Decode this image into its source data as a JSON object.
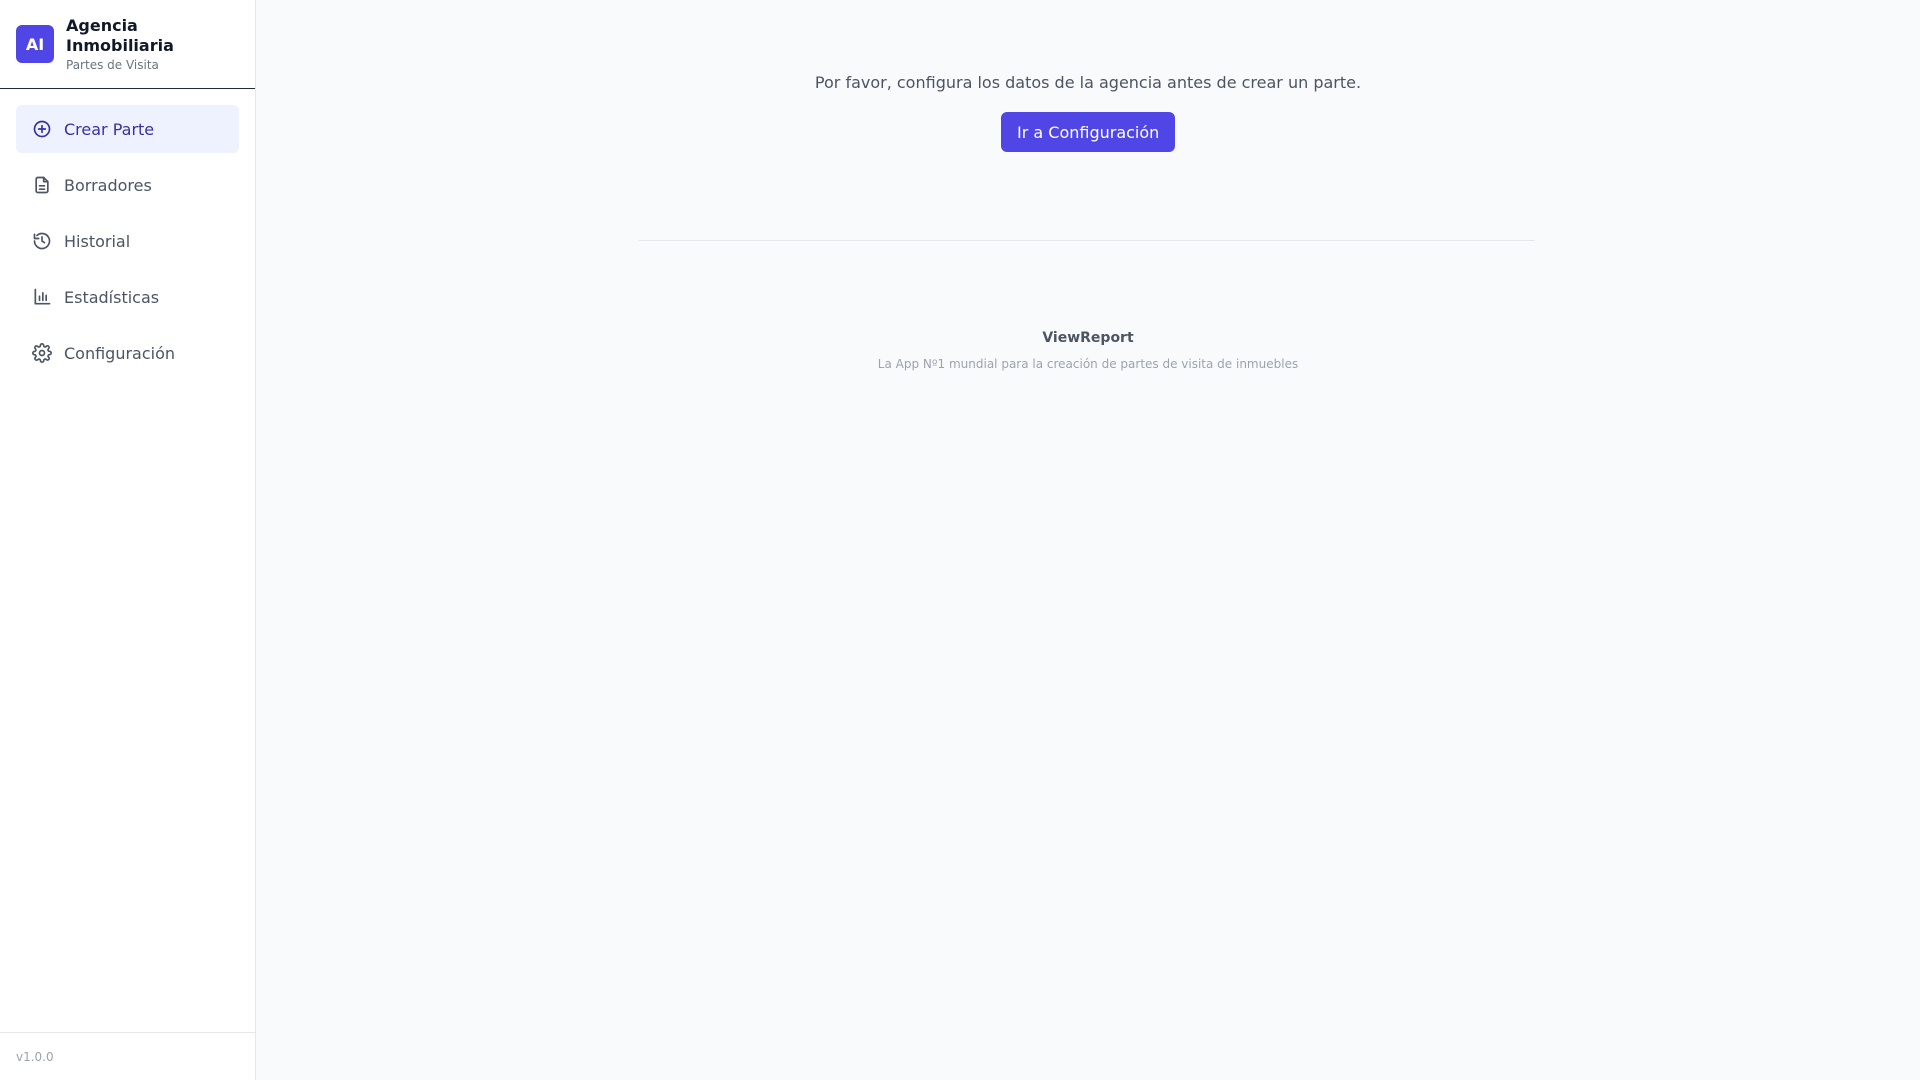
{
  "sidebar": {
    "logo_initials": "AI",
    "title": "Agencia Inmobiliaria",
    "subtitle": "Partes de Visita",
    "items": [
      {
        "label": "Crear Parte",
        "icon": "plus-circle-icon",
        "active": true
      },
      {
        "label": "Borradores",
        "icon": "document-icon",
        "active": false
      },
      {
        "label": "Historial",
        "icon": "history-icon",
        "active": false
      },
      {
        "label": "Estadísticas",
        "icon": "bar-chart-icon",
        "active": false
      },
      {
        "label": "Configuración",
        "icon": "gear-icon",
        "active": false
      }
    ],
    "version": "v1.0.0"
  },
  "main": {
    "message": "Por favor, configura los datos de la agencia antes de crear un parte.",
    "button_label": "Ir a Configuración",
    "footer_title": "ViewReport",
    "footer_tagline": "La App Nº1 mundial para la creación de partes de visita de inmuebles"
  },
  "colors": {
    "accent": "#4f46e5",
    "active_bg": "#eef2ff",
    "active_text": "#3730a3",
    "background": "#f9fafb"
  }
}
